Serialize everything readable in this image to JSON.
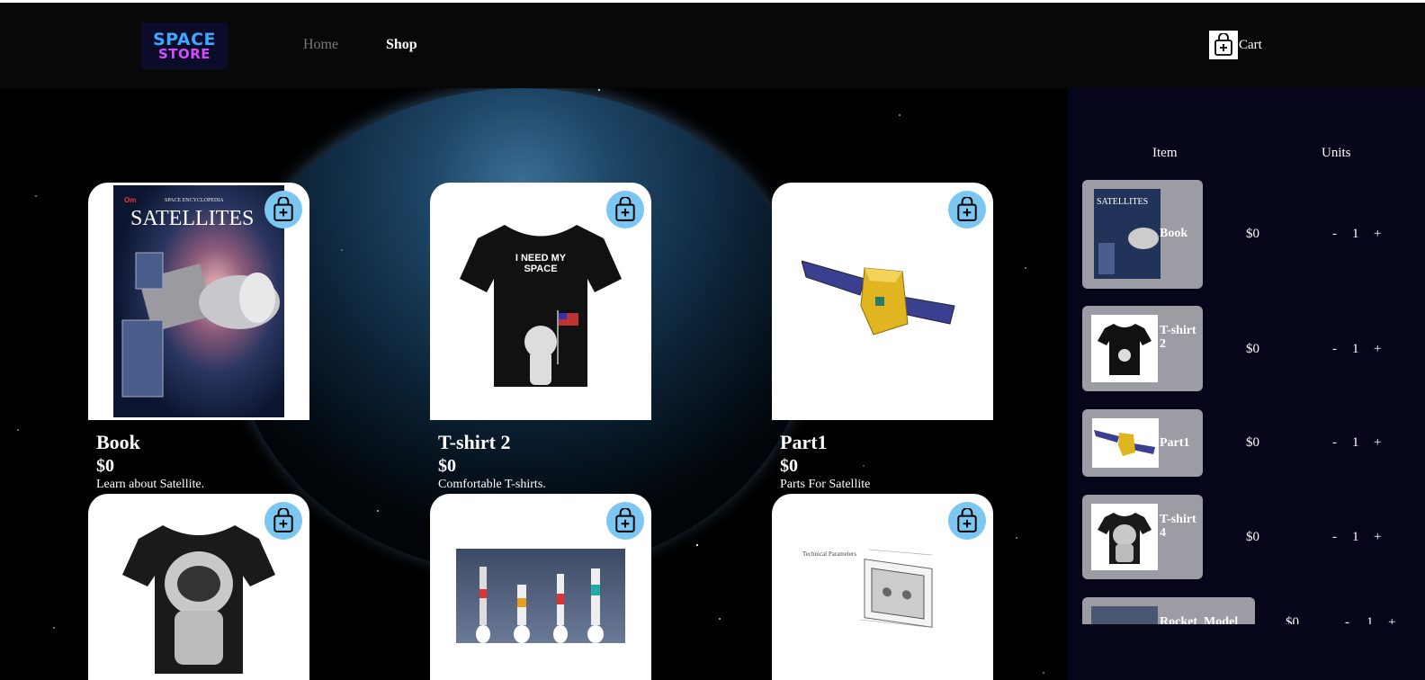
{
  "nav": {
    "logo_line1": "SPACE",
    "logo_line2": "STORE",
    "home_label": "Home",
    "shop_label": "Shop",
    "cart_label": "Cart"
  },
  "products": [
    {
      "name": "Book",
      "price": "$0",
      "description": "Learn about Satellite.",
      "image": "satellites-book-cover",
      "cover_title": "SATELLITES",
      "cover_subtitle": "SPACE ENCYCLOPEDIA",
      "cover_corner": "Om"
    },
    {
      "name": "T-shirt 2",
      "price": "$0",
      "description": "Comfortable T-shirts.",
      "image": "i-need-my-space-tshirt",
      "shirt_text": "I NEED MY SPACE"
    },
    {
      "name": "Part1",
      "price": "$0",
      "description": "Parts For Satellite",
      "image": "satellite-model"
    },
    {
      "name": "",
      "price": "",
      "description": "",
      "image": "astronaut-tshirt"
    },
    {
      "name": "",
      "price": "",
      "description": "",
      "image": "rocket-launches"
    },
    {
      "name": "",
      "price": "",
      "description": "",
      "image": "satellite-part-diagram",
      "diagram_caption": "Technical Parameters"
    }
  ],
  "cart": {
    "item_header": "Item",
    "units_header": "Units",
    "items": [
      {
        "name": "Book",
        "price": "$0",
        "qty": "1",
        "minus": "-",
        "plus": "+"
      },
      {
        "name": "T-shirt 2",
        "price": "$0",
        "qty": "1",
        "minus": "-",
        "plus": "+"
      },
      {
        "name": "Part1",
        "price": "$0",
        "qty": "1",
        "minus": "-",
        "plus": "+"
      },
      {
        "name": "T-shirt 4",
        "price": "$0",
        "qty": "1",
        "minus": "-",
        "plus": "+"
      },
      {
        "name": "Rocket_Model",
        "price": "$0",
        "qty": "1",
        "minus": "-",
        "plus": "+"
      }
    ]
  },
  "colors": {
    "add_button": "#7cc6f2",
    "cart_row": "#9c9ca4",
    "sidebar_bg": "#06061a"
  }
}
